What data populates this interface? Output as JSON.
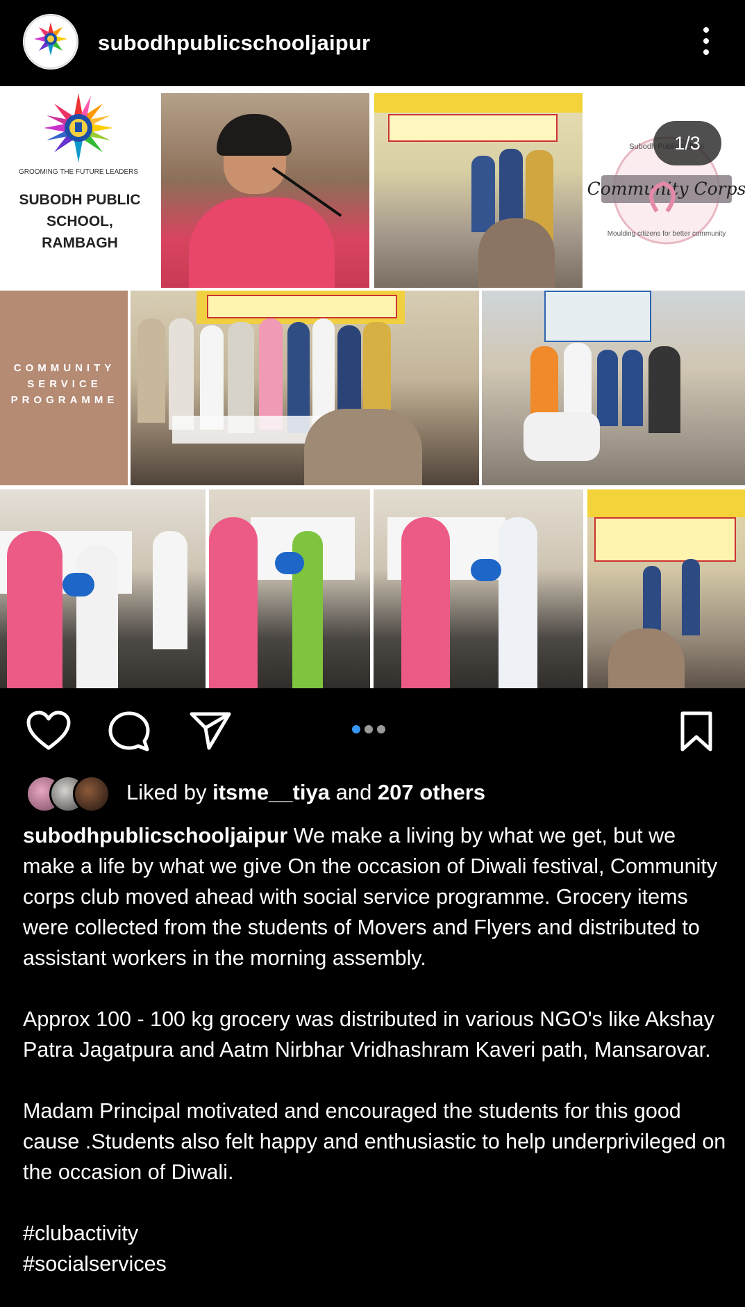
{
  "header": {
    "username": "subodhpublicschooljaipur"
  },
  "post": {
    "counter": "1/3",
    "school_logo_text": "GROOMING THE FUTURE LEADERS",
    "school_name": "SUBODH PUBLIC SCHOOL, RAMBAGH",
    "school_name_lines": [
      "SUBODH PUBLIC",
      "SCHOOL,",
      "RAMBAGH"
    ],
    "csp_lines": [
      "COMMUNITY",
      "SERVICE",
      "PROGRAMME"
    ],
    "corps_logo": {
      "arc_top": "Subodh Public School",
      "title": "Community Corps",
      "arc_bottom": "Moulding citizens for better community"
    }
  },
  "actions": {
    "carousel_dots": 3,
    "active_dot": 0
  },
  "likes": {
    "prefix": "Liked by ",
    "user": "itsme__tiya",
    "middle": " and ",
    "others": "207 others"
  },
  "caption": {
    "username": "subodhpublicschooljaipur",
    "para1": " We make a living by what we get, but we make a life by what we give On the occasion of Diwali festival, Community corps club moved ahead with social service programme. Grocery items were collected from the students of Movers and Flyers and distributed to assistant workers in the morning assembly.",
    "para2": "Approx 100 - 100 kg grocery was distributed in various NGO's like Akshay Patra Jagatpura and Aatm Nirbhar Vridhashram Kaveri path, Mansarovar.",
    "para3": "Madam Principal motivated and encouraged the students for this good cause .Students also felt happy and enthusiastic to help underprivileged on the occasion of Diwali.",
    "tag1": "#clubactivity",
    "tag2": "#socialservices"
  },
  "colors": {
    "background": "#000000",
    "accent_dot": "#3897f0",
    "csp_tile": "#b58b74"
  }
}
